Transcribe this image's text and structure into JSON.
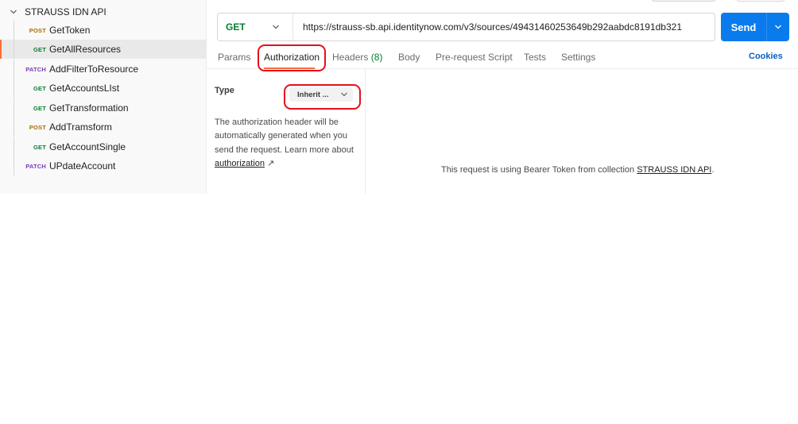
{
  "sidebar": {
    "collection_name": "STRAUSS IDN API",
    "items": [
      {
        "method": "POST",
        "name": "GetToken"
      },
      {
        "method": "GET",
        "name": "GetAllResources"
      },
      {
        "method": "PATCH",
        "name": "AddFilterToResource"
      },
      {
        "method": "GET",
        "name": "GetAccountsLIst"
      },
      {
        "method": "GET",
        "name": "GetTransformation"
      },
      {
        "method": "POST",
        "name": "AddTramsform"
      },
      {
        "method": "GET",
        "name": "GetAccountSingle"
      },
      {
        "method": "PATCH",
        "name": "UPdateAccount"
      }
    ]
  },
  "request": {
    "method": "GET",
    "url": "https://strauss-sb.api.identitynow.com/v3/sources/49431460253649b292aabdc8191db321",
    "send_label": "Send"
  },
  "tabs": {
    "params": "Params",
    "authorization": "Authorization",
    "headers": "Headers",
    "headers_count": "(8)",
    "body": "Body",
    "pre_request": "Pre-request Script",
    "tests": "Tests",
    "settings": "Settings",
    "cookies": "Cookies"
  },
  "auth": {
    "type_label": "Type",
    "type_value": "Inherit ...",
    "help_text": "The authorization header will be automatically generated when you send the request. Learn more about",
    "help_link": "authorization",
    "help_link_arrow": "↗",
    "bearer_prefix": "This request is using Bearer Token from collection",
    "bearer_collection": "STRAUSS IDN API",
    "bearer_suffix": "."
  },
  "colors": {
    "accent": "#ff6c37",
    "send_button": "#097bed",
    "get": "#007f31",
    "post": "#ab6d00",
    "patch": "#7a3db8",
    "highlight": "#e3111b"
  }
}
